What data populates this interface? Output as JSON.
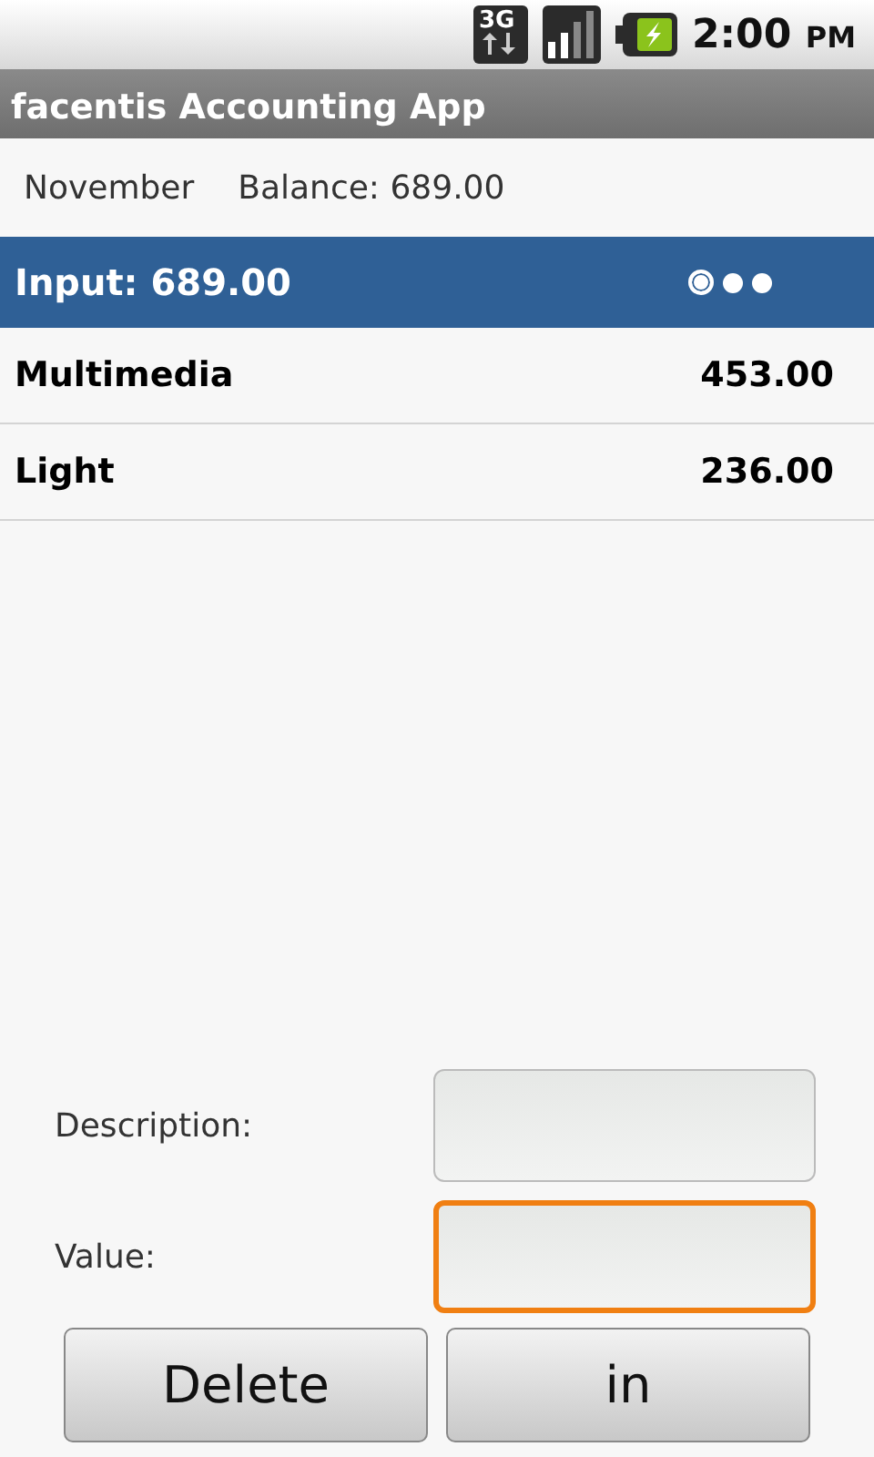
{
  "status_bar": {
    "network": "3G",
    "time": "2:00",
    "ampm": "PM"
  },
  "app_title": "facentis Accounting App",
  "summary": {
    "month": "November",
    "balance": "Balance: 689.00"
  },
  "header": {
    "title": "Input: 689.00",
    "pages": [
      {
        "selected": true
      },
      {
        "selected": false
      },
      {
        "selected": false
      }
    ]
  },
  "items": [
    {
      "name": "Multimedia",
      "amount": "453.00"
    },
    {
      "name": "Light",
      "amount": "236.00"
    }
  ],
  "form": {
    "fields": [
      {
        "label": "Description:",
        "focused": false
      },
      {
        "label": "Value:",
        "focused": true
      }
    ]
  },
  "buttons": [
    "Delete",
    "in"
  ]
}
